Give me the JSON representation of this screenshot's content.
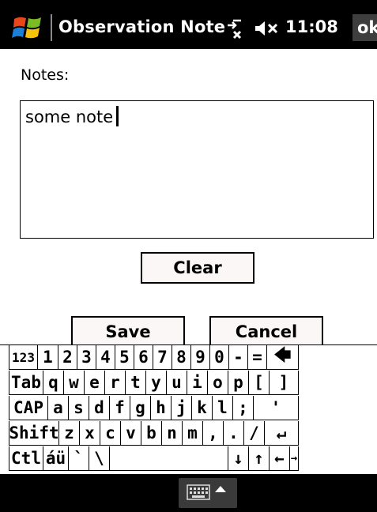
{
  "titlebar": {
    "title": "Observation Note",
    "time": "11:08",
    "ok_label": "ok"
  },
  "form": {
    "notes_label": "Notes:",
    "notes_value": "some note",
    "clear_label": "Clear",
    "save_label": "Save",
    "cancel_label": "Cancel"
  },
  "keyboard": {
    "rows": [
      [
        "123",
        "1",
        "2",
        "3",
        "4",
        "5",
        "6",
        "7",
        "8",
        "9",
        "0",
        "-",
        "=",
        "🡄"
      ],
      [
        "Tab",
        "q",
        "w",
        "e",
        "r",
        "t",
        "y",
        "u",
        "i",
        "o",
        "p",
        "[",
        "]"
      ],
      [
        "CAP",
        "a",
        "s",
        "d",
        "f",
        "g",
        "h",
        "j",
        "k",
        "l",
        ";",
        "'"
      ],
      [
        "Shift",
        "z",
        "x",
        "c",
        "v",
        "b",
        "n",
        "m",
        ",",
        ".",
        "/",
        "↵"
      ],
      [
        "Ctl",
        "áü",
        "`",
        "\\",
        "",
        "↓",
        "↑",
        "←",
        "→"
      ]
    ]
  },
  "icons": {
    "start": "windows-start-icon",
    "connectivity": "connectivity-icon",
    "volume": "volume-muted-icon",
    "input": "keyboard-icon"
  },
  "colors": {
    "titlebar_bg": "#000000",
    "button_bg": "#fbf7f7"
  }
}
